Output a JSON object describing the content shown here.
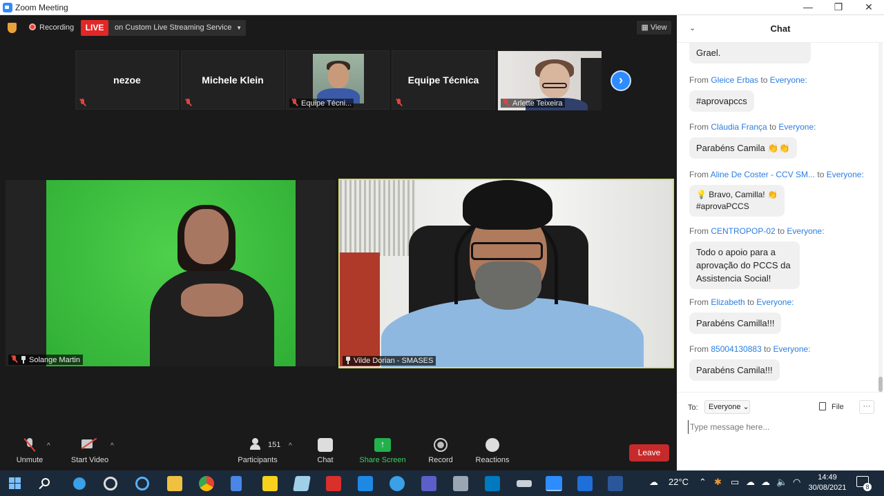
{
  "window": {
    "title": "Zoom Meeting",
    "minimize": "—",
    "restore": "❐",
    "close": "✕"
  },
  "meeting": {
    "recording_label": "Recording",
    "live_badge": "LIVE",
    "stream_label": "on Custom Live Streaming Service",
    "view_label": "View"
  },
  "gallery": [
    {
      "name": "nezoe",
      "label": "",
      "muted": true
    },
    {
      "name": "Michele Klein",
      "label": "",
      "muted": true
    },
    {
      "name": "",
      "label": "Equipe Técni...",
      "muted": true
    },
    {
      "name": "Equipe Técnica",
      "label": "",
      "muted": true
    },
    {
      "name": "",
      "label": "Arlette Teixeira",
      "muted": true
    }
  ],
  "videos": {
    "left_label": "Solange Martin",
    "right_label": "Vilde Dorian - SMASES"
  },
  "toolbar": {
    "unmute": "Unmute",
    "start_video": "Start Video",
    "participants": "Participants",
    "participant_count": "151",
    "chat": "Chat",
    "share_screen": "Share Screen",
    "record": "Record",
    "reactions": "Reactions",
    "leave": "Leave",
    "caret": "^"
  },
  "chat": {
    "title": "Chat",
    "from_word": "From",
    "to_word": "to",
    "top_partial": "Parabéns do Prefeito Axel Grael.",
    "messages": [
      {
        "sender": "Gleice Erbas",
        "recipient": "Everyone:",
        "text": "#aprovapccs"
      },
      {
        "sender": "Cláudia França",
        "recipient": "Everyone:",
        "text": "Parabéns Camila 👏👏"
      },
      {
        "sender": "Aline De Coster - CCV SM...",
        "recipient": "Everyone:",
        "text": "💡 Bravo, Camilla! 👏\n#aprovaPCCS"
      },
      {
        "sender": "CENTROPOP-02",
        "recipient": "Everyone:",
        "text": "Todo o apoio para a aprovação do PCCS da Assistencia Social!"
      },
      {
        "sender": "Elizabeth",
        "recipient": "Everyone:",
        "text": "Parabéns Camilla!!!"
      },
      {
        "sender": "85004130883",
        "recipient": "Everyone:",
        "text": "Parabéns Camila!!!"
      }
    ],
    "to_label": "To:",
    "to_value": "Everyone",
    "file_label": "File",
    "more": "···",
    "input_placeholder": "Type message here..."
  },
  "taskbar": {
    "temperature": "22°C",
    "time": "14:49",
    "date": "30/08/2021",
    "notifications": "8"
  }
}
